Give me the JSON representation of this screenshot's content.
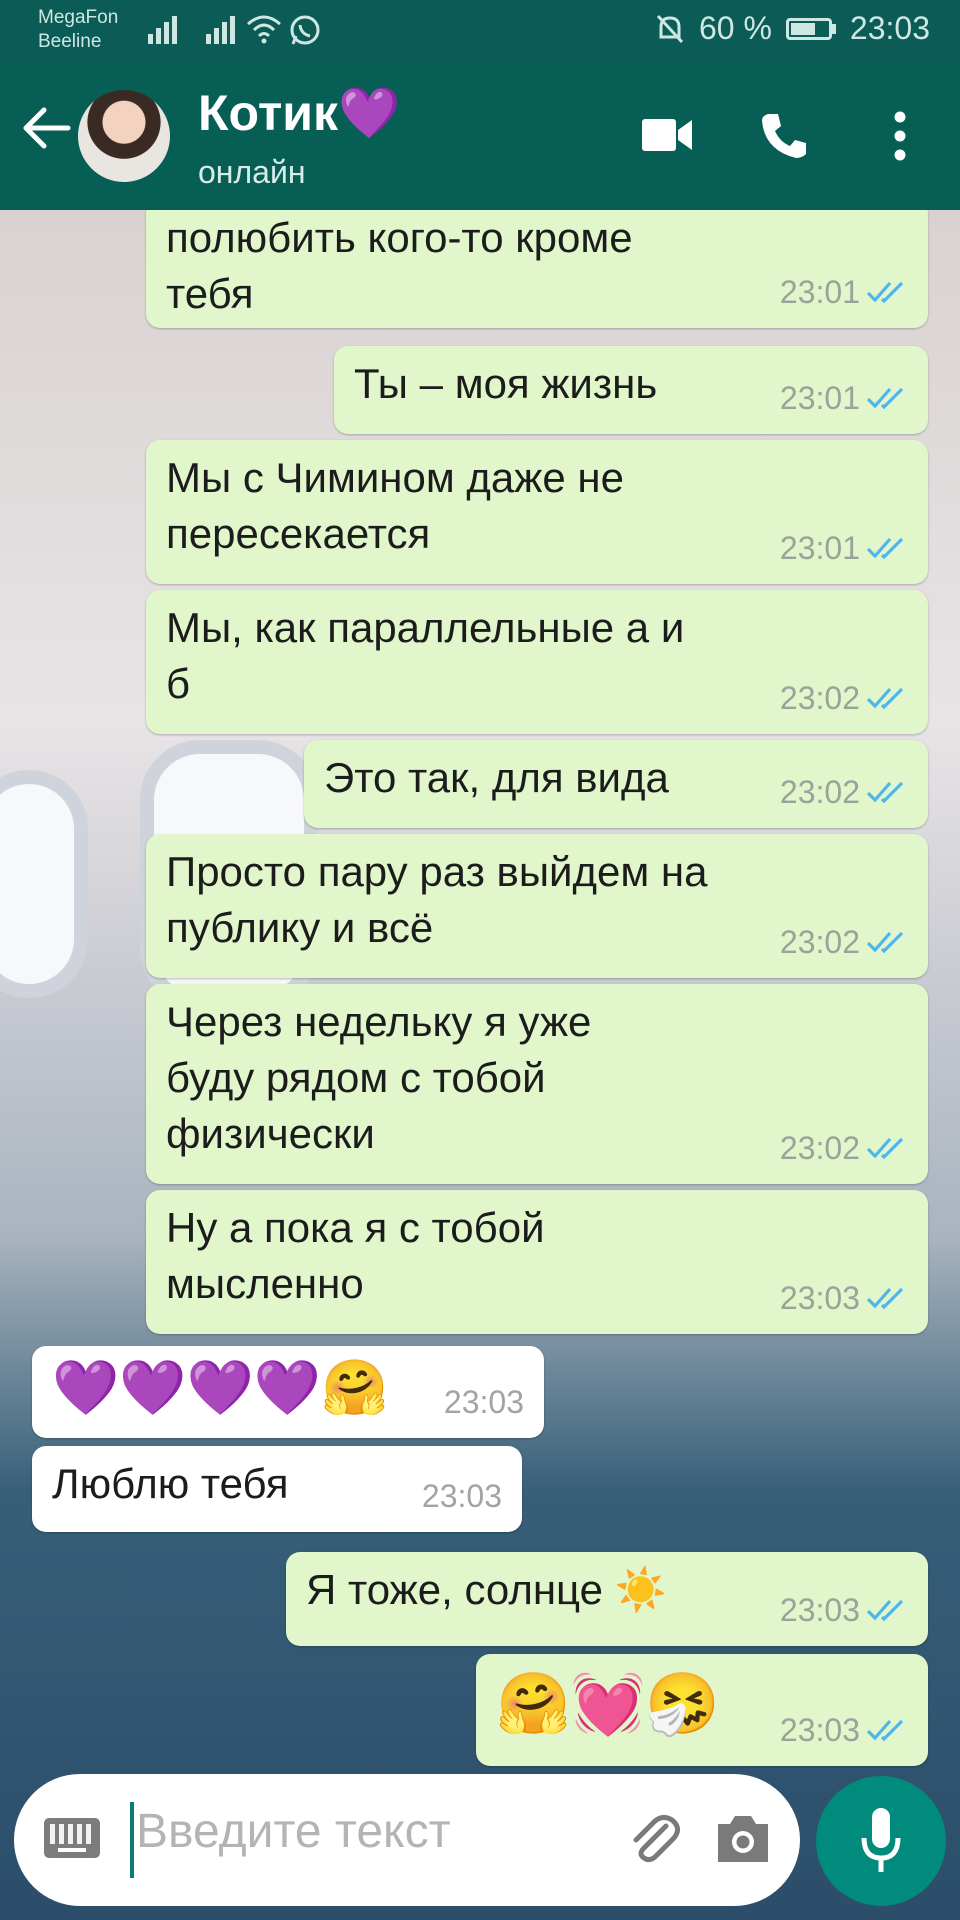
{
  "status_bar": {
    "carrier1": "MegaFon",
    "carrier2": "Beeline",
    "battery": "60 %",
    "time": "23:03"
  },
  "header": {
    "contact_name": "Котик💜",
    "status": "онлайн"
  },
  "messages": [
    {
      "dir": "out",
      "text": "полюбить кого-то кроме\nтебя",
      "time": "23:01"
    },
    {
      "dir": "out",
      "text": "Ты – моя жизнь",
      "time": "23:01"
    },
    {
      "dir": "out",
      "text": "Мы с Чимином даже не\nпересекается",
      "time": "23:01"
    },
    {
      "dir": "out",
      "text": "Мы, как параллельные а и\nб",
      "time": "23:02"
    },
    {
      "dir": "out",
      "text": "Это так, для вида",
      "time": "23:02"
    },
    {
      "dir": "out",
      "text": "Просто пару раз выйдем на\nпублику и всё",
      "time": "23:02"
    },
    {
      "dir": "out",
      "text": "Через недельку я уже\nбуду рядом с тобой\nфизически",
      "time": "23:02"
    },
    {
      "dir": "out",
      "text": "Ну а пока я с тобой\nмысленно",
      "time": "23:03"
    },
    {
      "dir": "in",
      "text": "💜💜💜💜🤗",
      "time": "23:03"
    },
    {
      "dir": "in",
      "text": "Люблю тебя",
      "time": "23:03"
    },
    {
      "dir": "out",
      "text": "Я тоже, солнце ☀️",
      "time": "23:03"
    },
    {
      "dir": "out",
      "text": "🤗💓🤧",
      "time": "23:03"
    }
  ],
  "input": {
    "placeholder": "Введите текст"
  },
  "colors": {
    "header_bg": "#075e54",
    "outgoing_bubble": "#e1f7cb",
    "incoming_bubble": "#ffffff",
    "read_tick": "#4fb6ec",
    "mic_button": "#008b7d"
  },
  "icons": [
    "back-arrow-icon",
    "video-call-icon",
    "phone-icon",
    "more-vert-icon",
    "keyboard-icon",
    "attach-icon",
    "camera-icon",
    "mic-icon",
    "read-ticks-icon"
  ]
}
